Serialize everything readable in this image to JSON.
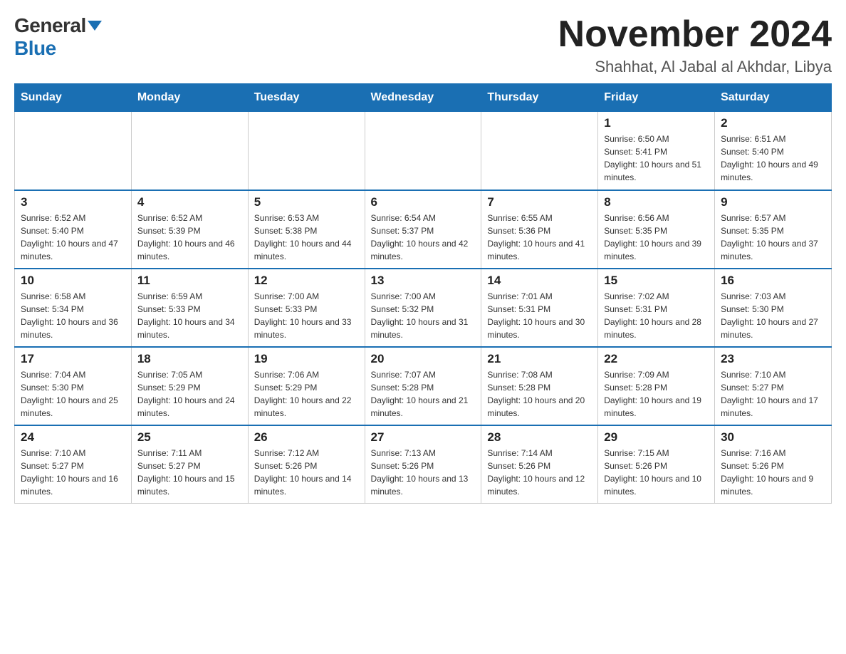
{
  "logo": {
    "general": "General",
    "blue": "Blue"
  },
  "header": {
    "month_title": "November 2024",
    "location": "Shahhat, Al Jabal al Akhdar, Libya"
  },
  "days_of_week": [
    "Sunday",
    "Monday",
    "Tuesday",
    "Wednesday",
    "Thursday",
    "Friday",
    "Saturday"
  ],
  "weeks": [
    [
      {
        "day": "",
        "info": ""
      },
      {
        "day": "",
        "info": ""
      },
      {
        "day": "",
        "info": ""
      },
      {
        "day": "",
        "info": ""
      },
      {
        "day": "",
        "info": ""
      },
      {
        "day": "1",
        "info": "Sunrise: 6:50 AM\nSunset: 5:41 PM\nDaylight: 10 hours and 51 minutes."
      },
      {
        "day": "2",
        "info": "Sunrise: 6:51 AM\nSunset: 5:40 PM\nDaylight: 10 hours and 49 minutes."
      }
    ],
    [
      {
        "day": "3",
        "info": "Sunrise: 6:52 AM\nSunset: 5:40 PM\nDaylight: 10 hours and 47 minutes."
      },
      {
        "day": "4",
        "info": "Sunrise: 6:52 AM\nSunset: 5:39 PM\nDaylight: 10 hours and 46 minutes."
      },
      {
        "day": "5",
        "info": "Sunrise: 6:53 AM\nSunset: 5:38 PM\nDaylight: 10 hours and 44 minutes."
      },
      {
        "day": "6",
        "info": "Sunrise: 6:54 AM\nSunset: 5:37 PM\nDaylight: 10 hours and 42 minutes."
      },
      {
        "day": "7",
        "info": "Sunrise: 6:55 AM\nSunset: 5:36 PM\nDaylight: 10 hours and 41 minutes."
      },
      {
        "day": "8",
        "info": "Sunrise: 6:56 AM\nSunset: 5:35 PM\nDaylight: 10 hours and 39 minutes."
      },
      {
        "day": "9",
        "info": "Sunrise: 6:57 AM\nSunset: 5:35 PM\nDaylight: 10 hours and 37 minutes."
      }
    ],
    [
      {
        "day": "10",
        "info": "Sunrise: 6:58 AM\nSunset: 5:34 PM\nDaylight: 10 hours and 36 minutes."
      },
      {
        "day": "11",
        "info": "Sunrise: 6:59 AM\nSunset: 5:33 PM\nDaylight: 10 hours and 34 minutes."
      },
      {
        "day": "12",
        "info": "Sunrise: 7:00 AM\nSunset: 5:33 PM\nDaylight: 10 hours and 33 minutes."
      },
      {
        "day": "13",
        "info": "Sunrise: 7:00 AM\nSunset: 5:32 PM\nDaylight: 10 hours and 31 minutes."
      },
      {
        "day": "14",
        "info": "Sunrise: 7:01 AM\nSunset: 5:31 PM\nDaylight: 10 hours and 30 minutes."
      },
      {
        "day": "15",
        "info": "Sunrise: 7:02 AM\nSunset: 5:31 PM\nDaylight: 10 hours and 28 minutes."
      },
      {
        "day": "16",
        "info": "Sunrise: 7:03 AM\nSunset: 5:30 PM\nDaylight: 10 hours and 27 minutes."
      }
    ],
    [
      {
        "day": "17",
        "info": "Sunrise: 7:04 AM\nSunset: 5:30 PM\nDaylight: 10 hours and 25 minutes."
      },
      {
        "day": "18",
        "info": "Sunrise: 7:05 AM\nSunset: 5:29 PM\nDaylight: 10 hours and 24 minutes."
      },
      {
        "day": "19",
        "info": "Sunrise: 7:06 AM\nSunset: 5:29 PM\nDaylight: 10 hours and 22 minutes."
      },
      {
        "day": "20",
        "info": "Sunrise: 7:07 AM\nSunset: 5:28 PM\nDaylight: 10 hours and 21 minutes."
      },
      {
        "day": "21",
        "info": "Sunrise: 7:08 AM\nSunset: 5:28 PM\nDaylight: 10 hours and 20 minutes."
      },
      {
        "day": "22",
        "info": "Sunrise: 7:09 AM\nSunset: 5:28 PM\nDaylight: 10 hours and 19 minutes."
      },
      {
        "day": "23",
        "info": "Sunrise: 7:10 AM\nSunset: 5:27 PM\nDaylight: 10 hours and 17 minutes."
      }
    ],
    [
      {
        "day": "24",
        "info": "Sunrise: 7:10 AM\nSunset: 5:27 PM\nDaylight: 10 hours and 16 minutes."
      },
      {
        "day": "25",
        "info": "Sunrise: 7:11 AM\nSunset: 5:27 PM\nDaylight: 10 hours and 15 minutes."
      },
      {
        "day": "26",
        "info": "Sunrise: 7:12 AM\nSunset: 5:26 PM\nDaylight: 10 hours and 14 minutes."
      },
      {
        "day": "27",
        "info": "Sunrise: 7:13 AM\nSunset: 5:26 PM\nDaylight: 10 hours and 13 minutes."
      },
      {
        "day": "28",
        "info": "Sunrise: 7:14 AM\nSunset: 5:26 PM\nDaylight: 10 hours and 12 minutes."
      },
      {
        "day": "29",
        "info": "Sunrise: 7:15 AM\nSunset: 5:26 PM\nDaylight: 10 hours and 10 minutes."
      },
      {
        "day": "30",
        "info": "Sunrise: 7:16 AM\nSunset: 5:26 PM\nDaylight: 10 hours and 9 minutes."
      }
    ]
  ]
}
